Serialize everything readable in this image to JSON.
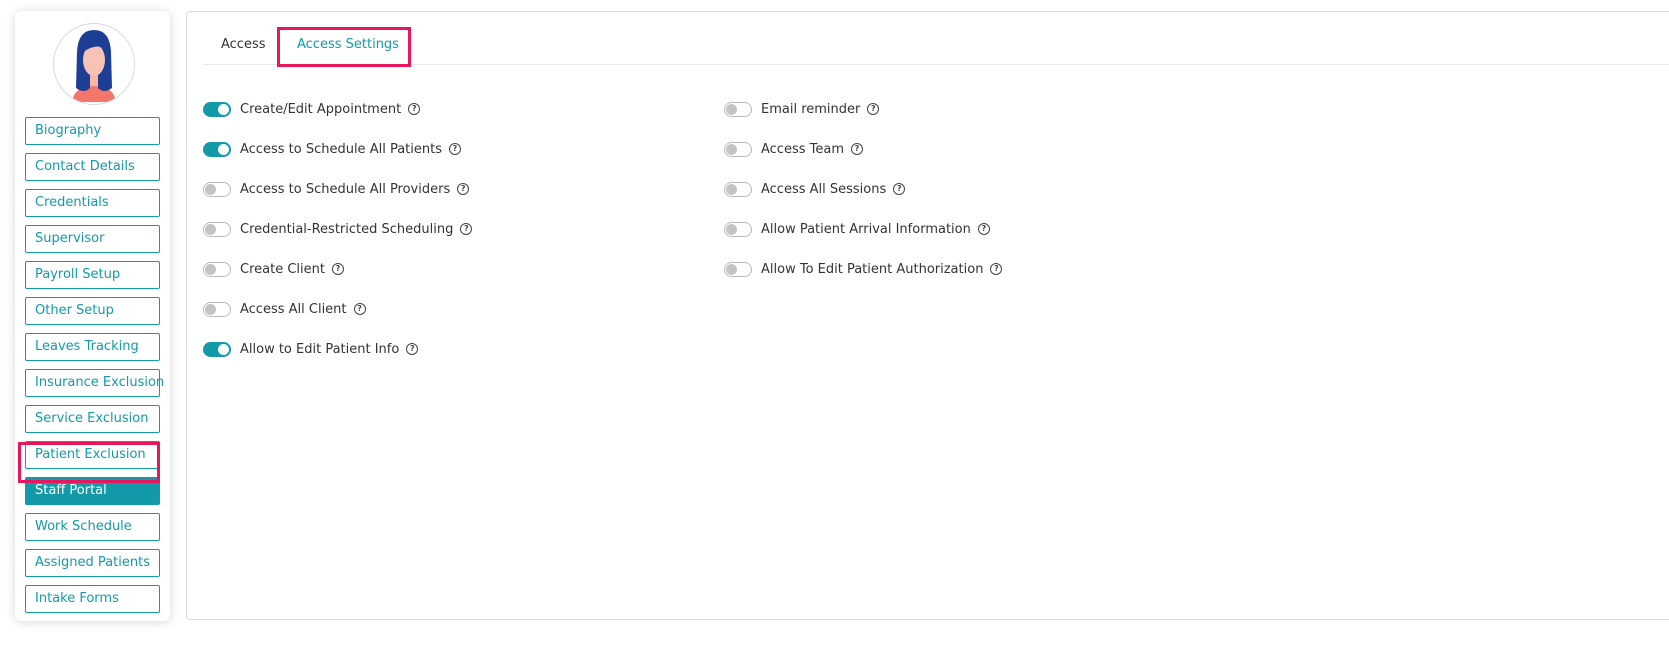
{
  "sidebar": {
    "avatar_icon": "female-user-avatar-icon",
    "items": [
      {
        "label": "Biography"
      },
      {
        "label": "Contact Details"
      },
      {
        "label": "Credentials"
      },
      {
        "label": "Supervisor"
      },
      {
        "label": "Payroll Setup"
      },
      {
        "label": "Other Setup"
      },
      {
        "label": "Leaves Tracking"
      },
      {
        "label": "Insurance Exclusion"
      },
      {
        "label": "Service Exclusion"
      },
      {
        "label": "Patient Exclusion"
      },
      {
        "label": "Staff Portal",
        "active": true
      },
      {
        "label": "Work Schedule"
      },
      {
        "label": "Assigned Patients"
      },
      {
        "label": "Intake Forms"
      }
    ]
  },
  "tabs": {
    "access": "Access",
    "access_settings": "Access Settings",
    "active": "Access Settings"
  },
  "settings": {
    "left": [
      {
        "label": "Create/Edit Appointment",
        "enabled": true
      },
      {
        "label": "Access to Schedule All Patients",
        "enabled": true
      },
      {
        "label": "Access to Schedule All Providers",
        "enabled": false
      },
      {
        "label": "Credential-Restricted Scheduling",
        "enabled": false
      },
      {
        "label": "Create Client",
        "enabled": false
      },
      {
        "label": "Access All Client",
        "enabled": false
      },
      {
        "label": "Allow to Edit Patient Info",
        "enabled": true
      }
    ],
    "right": [
      {
        "label": "Email reminder",
        "enabled": false
      },
      {
        "label": "Access Team",
        "enabled": false
      },
      {
        "label": "Access All Sessions",
        "enabled": false
      },
      {
        "label": "Allow Patient Arrival Information",
        "enabled": false
      },
      {
        "label": "Allow To Edit Patient Authorization",
        "enabled": false
      }
    ],
    "help_icon": "question-circle-icon",
    "help_glyph": "?"
  },
  "colors": {
    "accent": "#129aa9",
    "highlight": "#e8175d",
    "text": "#333333",
    "toggle_off_knob": "#c4c4c4"
  }
}
